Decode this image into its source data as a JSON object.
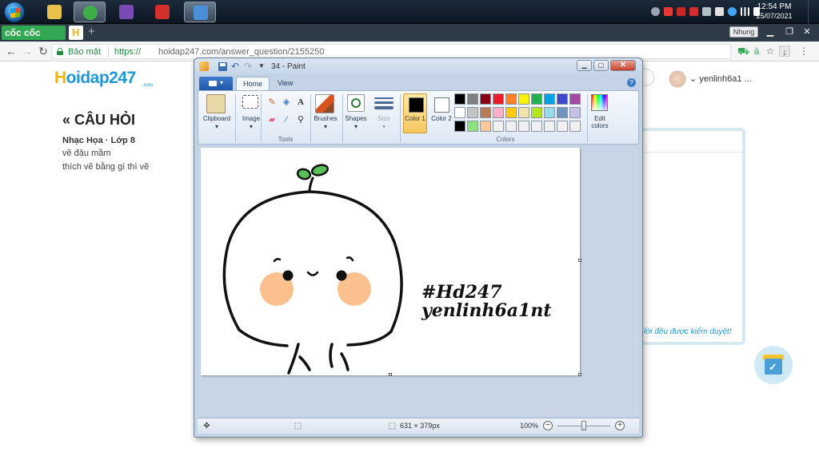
{
  "taskbar": {
    "apps": [
      {
        "name": "file-explorer",
        "color": "#e8c04c"
      },
      {
        "name": "coccoc-browser",
        "color": "#3fae49"
      },
      {
        "name": "game-app",
        "color": "#7a4ab5"
      },
      {
        "name": "media-app",
        "color": "#d32f2f"
      },
      {
        "name": "paint-app",
        "color": "#4a90d9"
      }
    ],
    "clock_time": "12:54 PM",
    "clock_date": "25/07/2021"
  },
  "browser": {
    "brand": "cốc cốc",
    "tab_favicon_letter": "H",
    "profile_name": "Nhung",
    "secure_label": "Bảo mật",
    "url_scheme": "https://",
    "url_rest": "hoidap247.com/answer_question/2155250"
  },
  "page": {
    "logo_first": "H",
    "logo_rest": "oidap247",
    "logo_sub": ".com",
    "heading": "« CÂU HỎI",
    "meta": "Nhạc Họa · Lớp 8",
    "question_lines": [
      "vẽ đậu mầm",
      "thích vẽ bằng gì thì vẽ"
    ],
    "user_name": "yenlinh6a1 ...",
    "moderation_note": "i lời đều được kiểm duyệt!"
  },
  "paint": {
    "title": "34 - Paint",
    "tabs": [
      "Home",
      "View"
    ],
    "groups": {
      "clipboard": "Clipboard",
      "image": "Image",
      "tools": "Tools",
      "brushes": "Brushes",
      "shapes": "Shapes",
      "size": "Size",
      "color1": "Color 1",
      "color2": "Color 2",
      "colors": "Colors",
      "edit_colors": "Edit colors"
    },
    "palette": [
      "#000000",
      "#7f7f7f",
      "#880015",
      "#ed1c24",
      "#ff7f27",
      "#fff200",
      "#22b14c",
      "#00a2e8",
      "#3f48cc",
      "#a349a4",
      "#ffffff",
      "#c3c3c3",
      "#b97a57",
      "#ffaec9",
      "#ffc90e",
      "#efe4b0",
      "#b5e61d",
      "#99d9ea",
      "#7092be",
      "#c8bfe7",
      "#000000",
      "#8ee07a",
      "#ffc89a",
      "#f0f0f0",
      "#f0f0f0",
      "#f0f0f0",
      "#f0f0f0",
      "#f0f0f0",
      "#f0f0f0",
      "#f0f0f0"
    ],
    "canvas_text_1": "#Hd247",
    "canvas_text_2": "yenlinh6a1nt",
    "status_size": "631 × 379px",
    "status_zoom": "100%"
  }
}
